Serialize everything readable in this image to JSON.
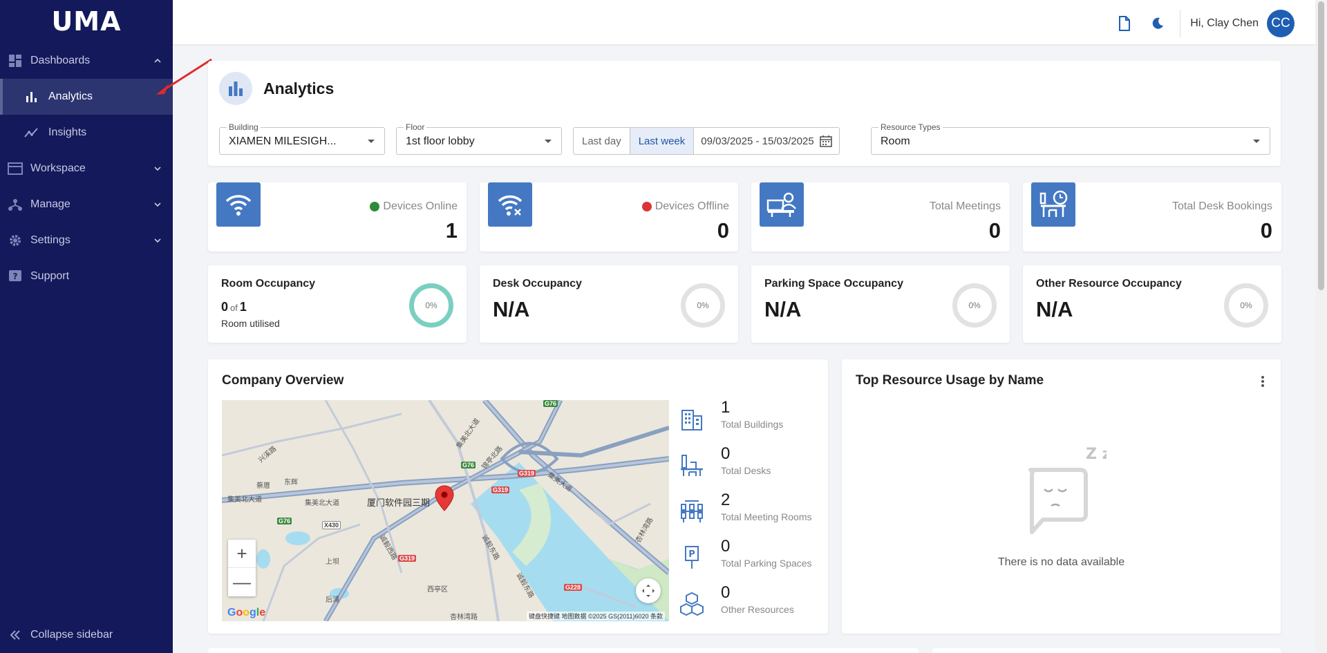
{
  "app": {
    "logo_text": "UMA"
  },
  "sidebar": {
    "dashboards": {
      "label": "Dashboards",
      "icon": "dashboard-icon"
    },
    "analytics": {
      "label": "Analytics",
      "icon": "bar-chart-icon"
    },
    "insights": {
      "label": "Insights",
      "icon": "trend-icon"
    },
    "workspace": {
      "label": "Workspace",
      "icon": "window-icon"
    },
    "manage": {
      "label": "Manage",
      "icon": "hierarchy-icon"
    },
    "settings": {
      "label": "Settings",
      "icon": "gear-icon"
    },
    "support": {
      "label": "Support",
      "icon": "help-icon"
    },
    "collapse": {
      "label": "Collapse sidebar",
      "icon": "double-chevron-left-icon"
    }
  },
  "topbar": {
    "greeting": "Hi, Clay Chen",
    "avatar_initials": "CC"
  },
  "page": {
    "title": "Analytics",
    "filters": {
      "building": {
        "label": "Building",
        "value": "XIAMEN MILESIGH..."
      },
      "floor": {
        "label": "Floor",
        "value": "1st floor lobby"
      },
      "periods": [
        "Last day",
        "Last week"
      ],
      "selected_period": "Last week",
      "date_range": "09/03/2025 - 15/03/2025",
      "resource_types": {
        "label": "Resource Types",
        "value": "Room"
      }
    }
  },
  "stats": [
    {
      "label": "Devices Online",
      "value": "1",
      "dot_color": "#2e8b3a",
      "icon": "wifi-icon"
    },
    {
      "label": "Devices Offline",
      "value": "0",
      "dot_color": "#d93535",
      "icon": "wifi-off-icon"
    },
    {
      "label": "Total Meetings",
      "value": "0",
      "icon": "meeting-icon"
    },
    {
      "label": "Total Desk Bookings",
      "value": "0",
      "icon": "desk-booking-icon"
    }
  ],
  "occupancy": [
    {
      "title": "Room Occupancy",
      "used": "0",
      "of": "of",
      "total": "1",
      "sub": "Room utilised",
      "percent": "0%",
      "ring_color": "#7bcfc0"
    },
    {
      "title": "Desk Occupancy",
      "value": "N/A",
      "percent": "0%"
    },
    {
      "title": "Parking Space Occupancy",
      "value": "N/A",
      "percent": "0%"
    },
    {
      "title": "Other Resource Occupancy",
      "value": "N/A",
      "percent": "0%"
    }
  ],
  "company": {
    "title": "Company Overview",
    "items": [
      {
        "value": "1",
        "label": "Total Buildings",
        "icon": "building-icon"
      },
      {
        "value": "0",
        "label": "Total Desks",
        "icon": "desk-icon"
      },
      {
        "value": "2",
        "label": "Total Meeting Rooms",
        "icon": "meeting-room-icon"
      },
      {
        "value": "0",
        "label": "Total Parking Spaces",
        "icon": "parking-icon"
      },
      {
        "value": "0",
        "label": "Other Resources",
        "icon": "cubes-icon"
      }
    ],
    "map": {
      "marker_label": "厦门软件园三期",
      "labels": [
        "集美北大道",
        "集美大道",
        "兴溪路",
        "锦亭北路",
        "诚毅西路",
        "诚毅东路",
        "西亭区",
        "杏林湾路",
        "上坝",
        "后浦",
        "东辉",
        "蔡厝",
        "后溪"
      ],
      "highways": [
        "G76",
        "G319",
        "G228",
        "X430"
      ],
      "attribution": "键盘快捷键  地图数据 ©2025 GS(2011)6020  条款",
      "zoom_in": "+",
      "zoom_out": "—",
      "logo": "Google"
    }
  },
  "usage": {
    "title": "Top Resource Usage by Name",
    "empty_message": "There is no data available",
    "sleep_glyph": "Z z"
  },
  "colors": {
    "sidebar_bg": "#13195a",
    "accent": "#4478c2",
    "avatar": "#1f5fb3"
  }
}
